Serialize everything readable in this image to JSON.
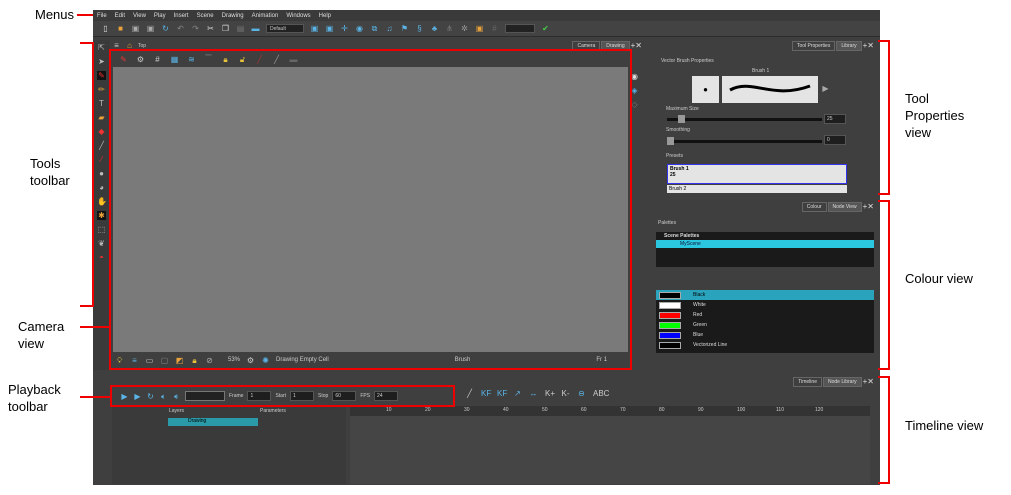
{
  "annotations": {
    "menus": "Menus",
    "tools": "Tools toolbar",
    "camera": "Camera view",
    "playback": "Playback toolbar",
    "toolprops": "Tool Properties view",
    "colour": "Colour view",
    "timeline": "Timeline view"
  },
  "menu": [
    "File",
    "Edit",
    "View",
    "Play",
    "Insert",
    "Scene",
    "Drawing",
    "Animation",
    "Windows",
    "Help"
  ],
  "toolbar": {
    "workspace": "Default"
  },
  "camera": {
    "breadcrumb": "Top",
    "tabs": [
      "Camera",
      "Drawing"
    ],
    "zoom": "53%",
    "cell": "Drawing Empty Cell",
    "tool": "Brush",
    "frame": "Fr 1"
  },
  "toolprops": {
    "tabs": [
      "Tool Properties",
      "Library"
    ],
    "group": "Vector Brush Properties",
    "brush": "Brush 1",
    "max_size_label": "Maximum Size",
    "max_size": "25",
    "smoothing_label": "Smoothing",
    "smoothing": "0",
    "presets_label": "Presets",
    "presets": [
      {
        "name": "Brush 1",
        "size": "25"
      },
      {
        "name": "Brush 2"
      }
    ],
    "max_size_fraction": 0.08,
    "smoothing_fraction": 0.0
  },
  "colour": {
    "tabs": [
      "Colour",
      "Node View"
    ],
    "palettes_label": "Palettes",
    "scene_palettes": "Scene Palettes",
    "palette": "MyScene",
    "swatches": [
      {
        "name": "Black",
        "color": "#000000"
      },
      {
        "name": "White",
        "color": "#ffffff"
      },
      {
        "name": "Red",
        "color": "#ff0000"
      },
      {
        "name": "Green",
        "color": "#00ff00"
      },
      {
        "name": "Blue",
        "color": "#0000ff"
      },
      {
        "name": "Vectorized Line",
        "color": "#000000"
      }
    ]
  },
  "playback": {
    "frame_label": "Frame",
    "frame": "1",
    "start_label": "Start",
    "start": "1",
    "stop_label": "Stop",
    "stop": "60",
    "fps_label": "FPS",
    "fps": "24"
  },
  "timeline": {
    "tabs": [
      "Timeline",
      "Node Library"
    ],
    "layers_label": "Layers",
    "parameters_label": "Parameters",
    "layer": "Drawing",
    "ticks": [
      "10",
      "20",
      "30",
      "40",
      "50",
      "60",
      "70",
      "80",
      "90",
      "100",
      "110",
      "120"
    ]
  }
}
